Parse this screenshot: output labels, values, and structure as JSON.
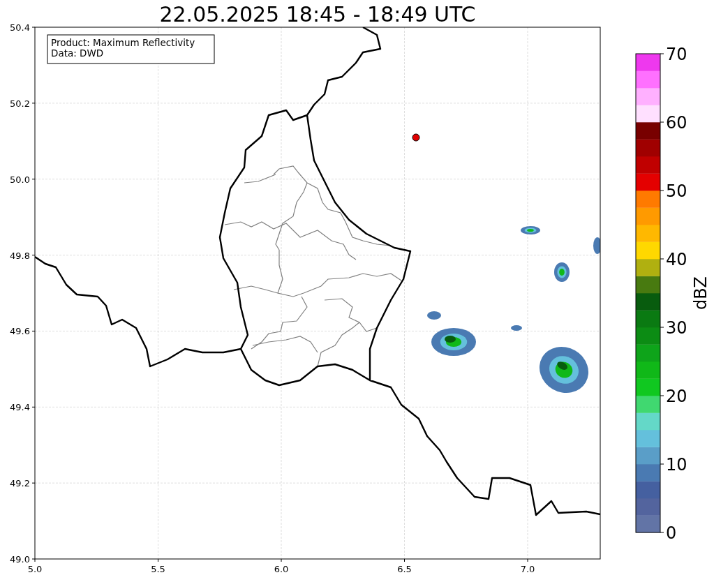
{
  "title": "22.05.2025 18:45 - 18:49 UTC",
  "info_box": {
    "lines": [
      "Product: Maximum Reflectivity",
      "Data: DWD"
    ]
  },
  "map": {
    "xticks": [
      "5.0",
      "5.5",
      "6.0",
      "6.5",
      "7.0"
    ],
    "yticks": [
      "50.4",
      "50.2",
      "50.0",
      "49.8",
      "49.6",
      "49.4",
      "49.2",
      "49.0"
    ]
  },
  "colorbar": {
    "label": "dBZ",
    "ticks": [
      "70",
      "60",
      "50",
      "40",
      "30",
      "20",
      "10",
      "0"
    ],
    "segments": [
      {
        "color": "#6274a6"
      },
      {
        "color": "#53649e"
      },
      {
        "color": "#4560a0"
      },
      {
        "color": "#4a7ab2"
      },
      {
        "color": "#5a9ec8"
      },
      {
        "color": "#64c0dc"
      },
      {
        "color": "#64d8c8"
      },
      {
        "color": "#40d870"
      },
      {
        "color": "#10c820"
      },
      {
        "color": "#10b818"
      },
      {
        "color": "#0ea41a"
      },
      {
        "color": "#0c8c14"
      },
      {
        "color": "#0a7a12"
      },
      {
        "color": "#085c0e"
      },
      {
        "color": "#487a10"
      },
      {
        "color": "#b0b010"
      },
      {
        "color": "#ffd800"
      },
      {
        "color": "#ffb800"
      },
      {
        "color": "#ff9a00"
      },
      {
        "color": "#ff7a00"
      },
      {
        "color": "#e40000"
      },
      {
        "color": "#c00000"
      },
      {
        "color": "#a00000"
      },
      {
        "color": "#780000"
      },
      {
        "color": "#ffe0ff"
      },
      {
        "color": "#ffb0ff"
      },
      {
        "color": "#ff70ff"
      },
      {
        "color": "#ee38ee"
      }
    ]
  }
}
